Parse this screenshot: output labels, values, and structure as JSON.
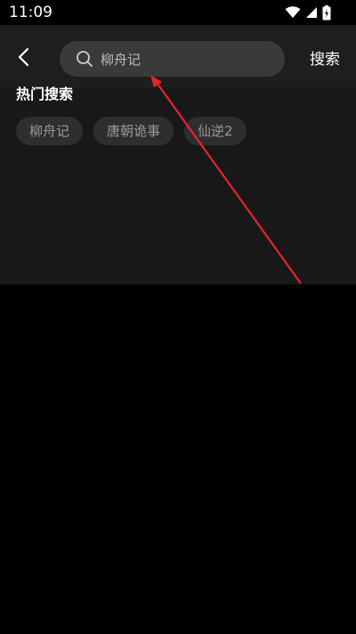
{
  "status_bar": {
    "time": "11:09",
    "icons": [
      "wifi-icon",
      "signal-icon",
      "battery-icon"
    ]
  },
  "header": {
    "back_icon": "chevron-left-icon",
    "search": {
      "icon": "search-icon",
      "value": "柳舟记"
    },
    "search_button_label": "搜索"
  },
  "hot_search": {
    "title": "热门搜索",
    "tags": [
      "柳舟记",
      "唐朝诡事",
      "仙逆2"
    ]
  },
  "colors": {
    "background": "#000000",
    "panel": "#181818",
    "search_box": "#3a3a3a",
    "tag": "#2e2e2e",
    "annotation_arrow": "#e8232a"
  }
}
